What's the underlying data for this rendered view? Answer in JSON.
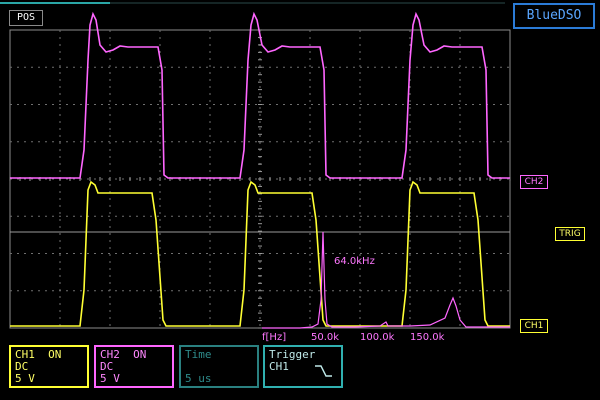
{
  "app": {
    "brand": "BlueDSO"
  },
  "header": {
    "position_badge": "POS"
  },
  "markers": {
    "ch2": "CH2",
    "trig": "TRIG",
    "ch1": "CH1"
  },
  "fft": {
    "axis_unit": "f[Hz]",
    "tick_labels": [
      "50.0k",
      "100.0k",
      "150.0k"
    ],
    "peak_label": "64.0kHz"
  },
  "panels": {
    "ch1": {
      "name": "CH1",
      "state": "ON",
      "coupling": "DC",
      "scale": "5 V"
    },
    "ch2": {
      "name": "CH2",
      "state": "ON",
      "coupling": "DC",
      "scale": "5 V"
    },
    "time": {
      "title": "Time",
      "value": "5 us"
    },
    "trigger": {
      "title": "Trigger",
      "source": "CH1",
      "slope_icon": "falling-edge-icon"
    }
  },
  "colors": {
    "ch1": "#ffff33",
    "ch2": "#ff66ff",
    "grid": "#8c8c8c",
    "brand": "#2b7bd6",
    "time_panel": "#2a8080",
    "trigger_panel": "#30b0b0"
  }
}
